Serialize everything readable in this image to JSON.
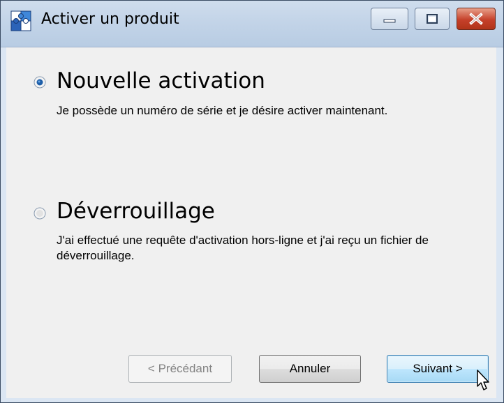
{
  "window": {
    "title": "Activer un produit",
    "controls": {
      "minimize_icon": "minimize-icon",
      "maximize_icon": "maximize-icon",
      "close_icon": "close-icon"
    },
    "app_icon": "puzzle-icon"
  },
  "options": [
    {
      "title": "Nouvelle activation",
      "description": "Je possède un numéro de série et je désire activer maintenant.",
      "selected": true
    },
    {
      "title": "Déverrouillage",
      "description": "J'ai effectué une requête d'activation hors-ligne et j'ai reçu un fichier de déverrouillage.",
      "selected": false
    }
  ],
  "buttons": {
    "previous": "< Précédant",
    "cancel": "Annuler",
    "next": "Suivant >"
  },
  "colors": {
    "accent": "#3c7fb1",
    "close_button": "#c5402a",
    "titlebar": "#c3d4e8"
  }
}
